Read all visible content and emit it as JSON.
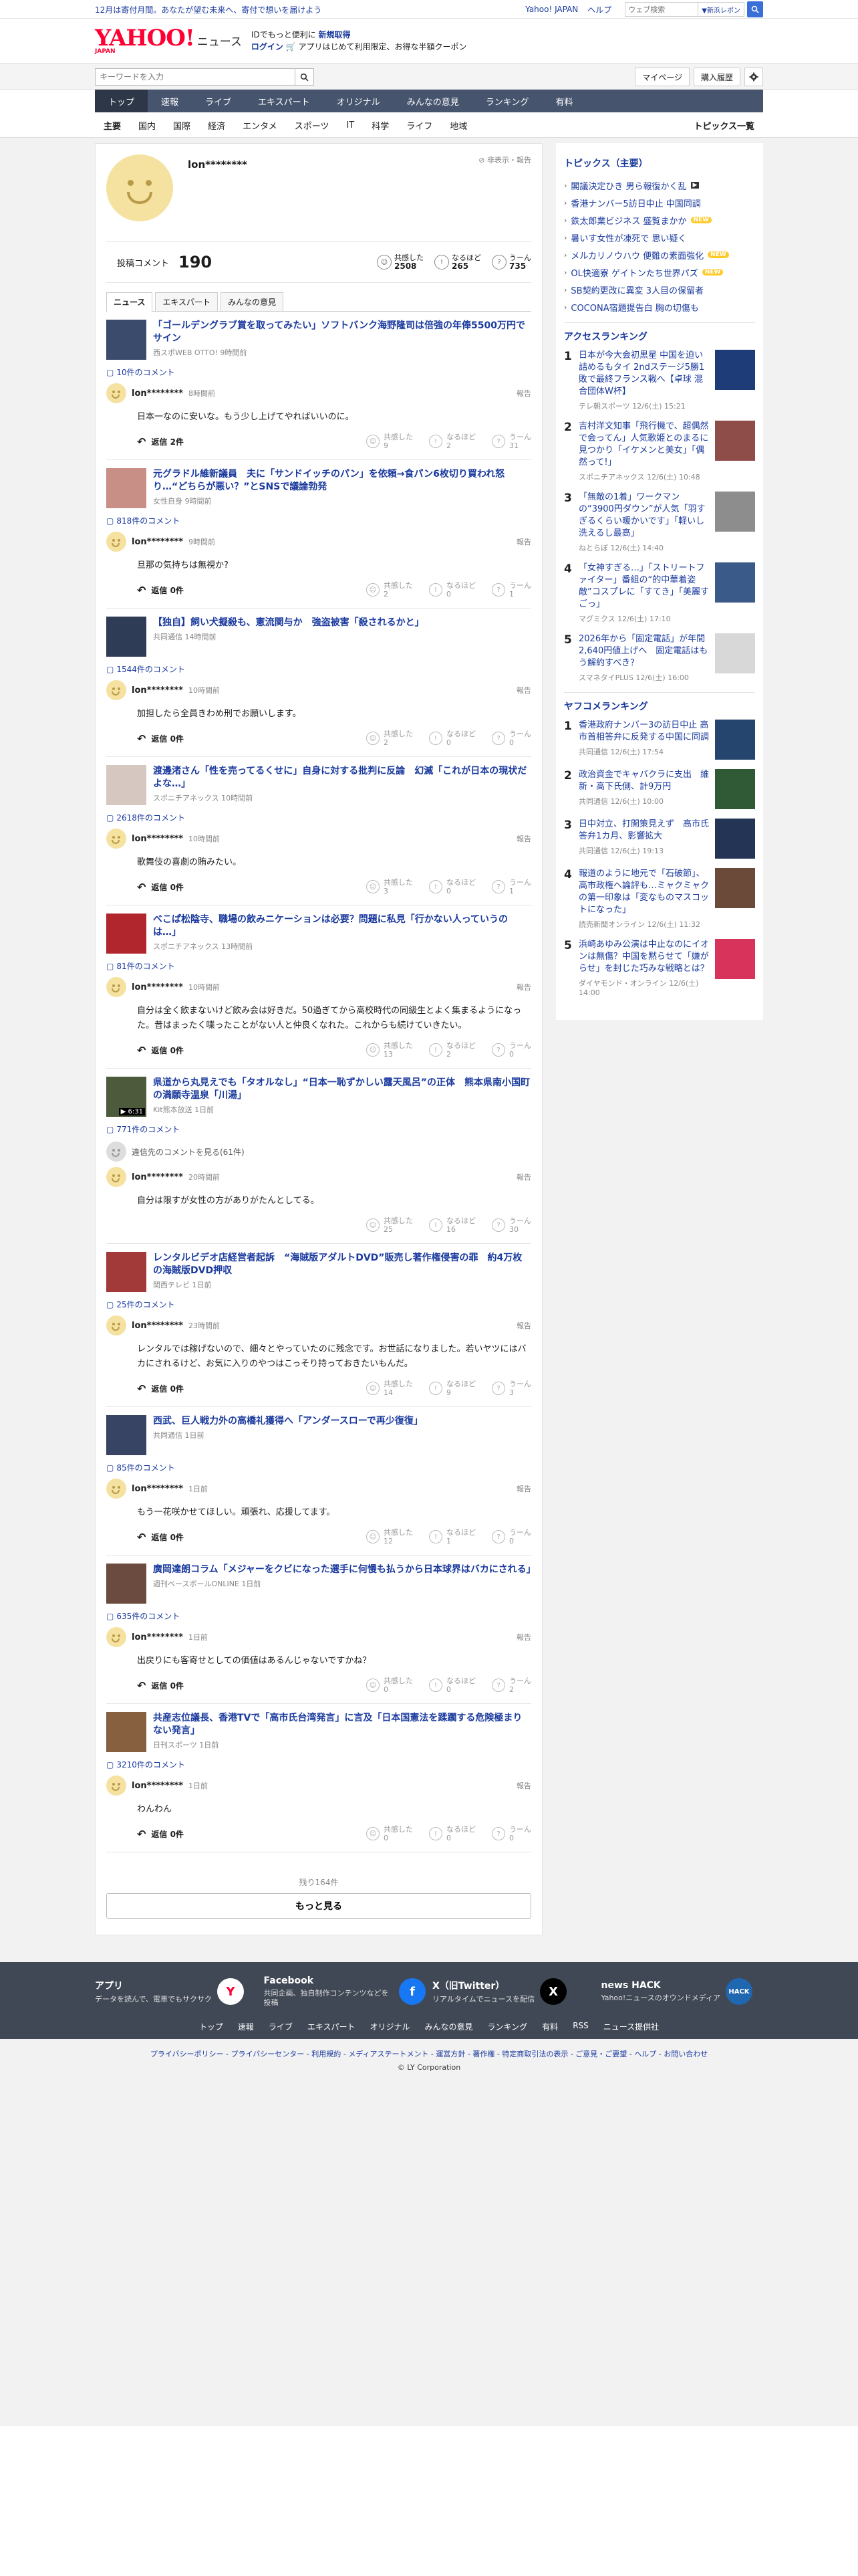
{
  "promo": {
    "text": "12月は寄付月間。あなたが望む未来へ、寄付で想いを届けよう",
    "links": [
      "Yahoo! JAPAN",
      "ヘルプ"
    ],
    "search_placeholder": "ウェブ検索",
    "search_mode": "▼新浜レポン"
  },
  "logo": {
    "main": "YAHOO!",
    "sub": "JAPAN",
    "news": "ニュース"
  },
  "logo_promo": {
    "line1a": "IDでもっと便利に",
    "line1b": "新規取得",
    "line2a": "ログイン",
    "line2b": "🛒 アプリはじめて利用限定、お得な半額クーポン"
  },
  "search": {
    "placeholder": "キーワードを入力",
    "mypage": "マイページ",
    "purchase": "購入履歴"
  },
  "mainnav": [
    "トップ",
    "速報",
    "ライブ",
    "エキスパート",
    "オリジナル",
    "みんなの意見",
    "ランキング",
    "有料"
  ],
  "subnav": [
    "主要",
    "国内",
    "国際",
    "経済",
    "エンタメ",
    "スポーツ",
    "IT",
    "科学",
    "ライフ",
    "地域"
  ],
  "subnav_all": "トピックス一覧",
  "profile": {
    "name": "lon********",
    "hide": "非表示・報告",
    "count_label": "投稿コメント",
    "count": "190",
    "reactions": [
      {
        "icon": "☺",
        "label": "共感した",
        "value": "2508"
      },
      {
        "icon": "!",
        "label": "なるほど",
        "value": "265"
      },
      {
        "icon": "?",
        "label": "うーん",
        "value": "735"
      }
    ],
    "tabs": [
      "ニュース",
      "エキスパート",
      "みんなの意見"
    ]
  },
  "labels": {
    "report": "報告",
    "empathy": "共感した",
    "naruhodo": "なるほど",
    "uun": "うーん"
  },
  "blocks": [
    {
      "title": "「ゴールデングラブ賞を取ってみたい」ソフトバンク海野隆司は倍強の年俸5500万円でサイン",
      "source": "西スポWEB OTTO! 9時間前",
      "comments_count": "10件のコメント",
      "thumb": "#3b4b6b",
      "user": "lon********",
      "time": "8時間前",
      "text": "日本一なのに安いな。もう少し上げてやればいいのに。",
      "reply": "返信 2件",
      "votes": [
        "9",
        "2",
        "31"
      ]
    },
    {
      "title": "元グラドル維新議員　夫に「サンドイッチのパン」を依頼→食パン6枚切り買われ怒り…“どちらが悪い？”とSNSで議論勃発",
      "source": "女性自身 9時間前",
      "comments_count": "818件のコメント",
      "thumb": "#c88f86",
      "user": "lon********",
      "time": "9時間前",
      "text": "旦那の気持ちは無視か?",
      "reply": "返信 0件",
      "votes": [
        "2",
        "0",
        "1"
      ]
    },
    {
      "title": "【独自】飼い犬擬殺も、憲流関与か　強盗被害「殺されるかと」",
      "source": "共同通信 14時間前",
      "comments_count": "1544件のコメント",
      "thumb": "#2f3c55",
      "user": "lon********",
      "time": "10時間前",
      "text": "加担したら全員きわめ刑でお願いします。",
      "reply": "返信 0件",
      "votes": [
        "2",
        "0",
        "0"
      ]
    },
    {
      "title": "渡邊渚さん「性を売ってるくせに」自身に対する批判に反論　幻滅「これが日本の現状だよな…」",
      "source": "スポニチアネックス 10時間前",
      "comments_count": "2618件のコメント",
      "thumb": "#d6c8c0",
      "user": "lon********",
      "time": "10時間前",
      "text": "歌舞伎の喜劇の賄みたい。",
      "reply": "返信 0件",
      "votes": [
        "3",
        "0",
        "1"
      ]
    },
    {
      "title": "べこぱ松陰寺、職場の飲みニケーションは必要？問題に私見「行かない人っていうのは…」",
      "source": "スポニチアネックス 13時間前",
      "comments_count": "81件のコメント",
      "thumb": "#b1252d",
      "user": "lon********",
      "time": "10時間前",
      "text": "自分は全く飲まないけど飲み会は好きだ。50過ぎてから高校時代の同級生とよく集まるようになった。昔はまったく喋ったことがない人と仲良くなれた。これからも続けていきたい。",
      "reply": "返信 0件",
      "votes": [
        "13",
        "2",
        "0"
      ]
    },
    {
      "title": "県道から丸見えでも「タオルなし」“日本一恥ずかしい露天風呂”の正体　熊本県南小国町の満願寺温泉「川湯」",
      "source": "Kit熊本放送 1日前",
      "comments_count": "771件のコメント",
      "thumb": "#4e5a3c",
      "thumb_label": "▶ 6:31",
      "hidden": "違信先のコメントを見る(61件)",
      "user": "lon********",
      "time": "20時間前",
      "text": "自分は限すが女性の方がありがたんとしてる。",
      "reply": "",
      "votes": [
        "25",
        "16",
        "30"
      ]
    },
    {
      "title": "レンタルビデオ店経営者起訴　“海賊版アダルトDVD”販売し著作権侵害の罪　約4万枚の海賊版DVD押収",
      "source": "関西テレビ 1日前",
      "comments_count": "25件のコメント",
      "thumb": "#a23a3a",
      "user": "lon********",
      "time": "23時間前",
      "text": "レンタルでは稼げないので、細々とやっていたのに残念です。お世話になりました。若いヤツにはバカにされるけど、お気に入りのやつはこっそり持っておきたいもんだ。",
      "reply": "返信 0件",
      "votes": [
        "14",
        "9",
        "3"
      ]
    },
    {
      "title": "西武、巨人戦力外の高橋礼獲得へ「アンダースローで再少復復」",
      "source": "共同通信 1日前",
      "comments_count": "85件のコメント",
      "thumb": "#374463",
      "user": "lon********",
      "time": "1日前",
      "text": "もう一花咲かせてほしい。頑張れ、応援してます。",
      "reply": "返信 0件",
      "votes": [
        "12",
        "1",
        "0"
      ]
    },
    {
      "title": "廣岡達朗コラム「メジャーをクビになった選手に何慢も払うから日本球界はバカにされる」",
      "source": "週刊ベースボールONLINE 1日前",
      "comments_count": "635件のコメント",
      "thumb": "#6b4a3f",
      "user": "lon********",
      "time": "1日前",
      "text": "出戻りにも客寄せとしての価値はあるんじゃないですかね？",
      "reply": "返信 0件",
      "votes": [
        "0",
        "0",
        "2"
      ]
    },
    {
      "title": "共産志位議長、香港TVで「高市氏台湾発言」に言及「日本国憲法を蹂躙する危険極まりない発言」",
      "source": "日刊スポーツ 1日前",
      "comments_count": "3210件のコメント",
      "thumb": "#87603f",
      "user": "lon********",
      "time": "1日前",
      "text": "わんわん",
      "reply": "返信 0件",
      "votes": [
        "0",
        "0",
        "0"
      ]
    }
  ],
  "more": {
    "remain": "残り164件",
    "button": "もっと見る"
  },
  "topics": {
    "title": "トピックス（主要）",
    "items": [
      {
        "text": "閣議決定ひき 男ら報復かく乱",
        "badge": "cam"
      },
      {
        "text": "香港ナンバー5訪日中止 中国同調",
        "badge": ""
      },
      {
        "text": "鉄太郎業ビジネス 盛覧まかか",
        "badge": "new"
      },
      {
        "text": "暑いす女性が凍死で 思い疑く",
        "badge": ""
      },
      {
        "text": "メルカリノウハウ 便難の素面強化",
        "badge": "new"
      },
      {
        "text": "OL快適寮 ゲイトンたち世界パズ",
        "badge": "new"
      },
      {
        "text": "SB契約更改に異変 3人目の保留者",
        "badge": ""
      },
      {
        "text": "COCONA宿題提告白 胸の切傷も",
        "badge": ""
      }
    ]
  },
  "access_ranking": {
    "title": "アクセスランキング",
    "items": [
      {
        "n": "1",
        "text": "日本が今大会初黒星 中国を迫い詰めるもタイ 2ndステージ5勝1敗で最終フランス戦へ【卓球 混合団体W杯】",
        "src": "テレ朝スポーツ 12/6(土) 15:21",
        "thumb": "#1d3c78"
      },
      {
        "n": "2",
        "text": "吉村洋文知事「飛行機で、超偶然で会ってん」人気歌姫とのまるに見つかり「イケメンと美女」「偶然って!」",
        "src": "スポニチアネックス 12/6(土) 10:48",
        "thumb": "#8f4d4a"
      },
      {
        "n": "3",
        "text": "「無敵の1着」ワークマンの“3900円ダウン”が人気「羽すぎるくらい暖かいです」「軽いし洗えるし最高」",
        "src": "ねとらぼ 12/6(土) 14:40",
        "thumb": "#8d8d8d"
      },
      {
        "n": "4",
        "text": "「女神すぎる…」「ストリートファイター」番組の“的中華着姿敵”コスプレに「すてき」「美麗すごっ」",
        "src": "マグミクス 12/6(土) 17:10",
        "thumb": "#3a5a8a"
      },
      {
        "n": "5",
        "text": "2026年から「固定電話」が年間2,640円値上げへ　固定電話はもう解約すべき？",
        "src": "スマネタイPLUS 12/6(土) 16:00",
        "thumb": "#d8d8d8"
      }
    ]
  },
  "yafuko_ranking": {
    "title": "ヤフコメランキング",
    "items": [
      {
        "n": "1",
        "text": "香港政府ナンバー3の訪日中止 高市首相答弁に反発する中国に同調",
        "src": "共同通信 12/6(土) 17:54",
        "thumb": "#26456e"
      },
      {
        "n": "2",
        "text": "政治資金でキャバクラに支出　維新・高下氏側、計9万円",
        "src": "共同通信 12/6(土) 10:00",
        "thumb": "#2f5a35"
      },
      {
        "n": "3",
        "text": "日中対立、打開策見えず　高市氏答弁1カ月、影響拡大",
        "src": "共同通信 12/6(土) 19:13",
        "thumb": "#243455"
      },
      {
        "n": "4",
        "text": "報道のように地元で「石破節」、高市政権へ論評も…ミャクミャクの第一印象は「変なものマスコットになった」",
        "src": "読売新聞オンライン 12/6(土) 11:32",
        "thumb": "#6b4a3a"
      },
      {
        "n": "5",
        "text": "浜崎あゆみ公演は中止なのにイオンは無傷？中国を黙らせて「嫌がらせ」を封じた巧みな戦略とは？",
        "src": "ダイヤモンド・オンライン 12/6(土) 14:00",
        "thumb": "#d8335a"
      }
    ]
  },
  "footer": {
    "apps": [
      {
        "title": "アプリ",
        "desc": "データを読んで、電車でもサクサク",
        "icon": "Y",
        "color": "#ffffff"
      },
      {
        "title": "Facebook",
        "desc": "共同企画、独自制作コンテンツなどを投稿",
        "icon": "f",
        "color": "#1877f2"
      },
      {
        "title": "X（旧Twitter）",
        "desc": "リアルタイムでニュースを配信",
        "icon": "X",
        "color": "#000000"
      },
      {
        "title": "news HACK",
        "desc": "Yahoo!ニュースのオウンドメディア",
        "icon": "HACK",
        "color": "#1f67b0"
      }
    ],
    "nav": [
      "トップ",
      "速報",
      "ライブ",
      "エキスパート",
      "オリジナル",
      "みんなの意見",
      "ランキング",
      "有料",
      "RSS",
      "ニュース提供社"
    ],
    "bottom": "プライバシーポリシー - プライバシーセンター - 利用規約 - メディアステートメント - 運営方針 - 著作権 - 特定商取引法の表示 - ご意見・ご要望 - ヘルプ - お問い合わせ",
    "copyright": "© LY Corporation"
  }
}
